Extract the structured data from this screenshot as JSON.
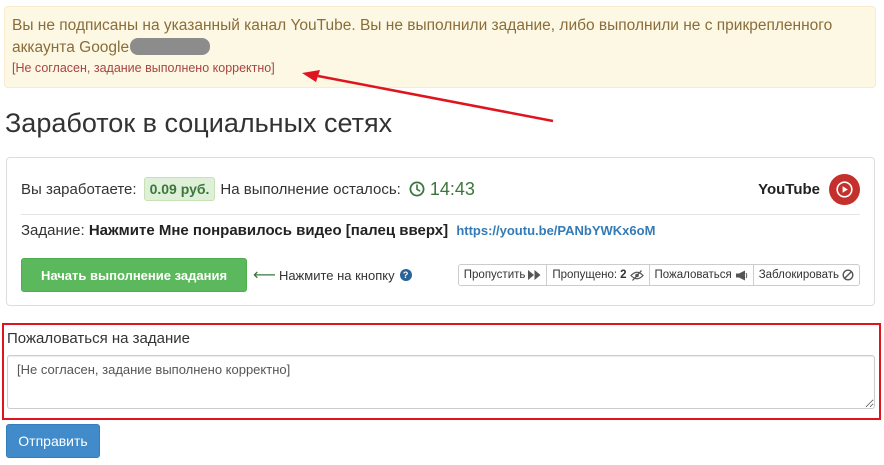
{
  "alert": {
    "message": "Вы не подписаны на указанный канал YouTube. Вы не выполнили задание, либо выполнили не с прикрепленного аккаунта Google",
    "dispute_link": "[Не согласен, задание выполнено корректно]"
  },
  "page": {
    "title": "Заработок в социальных сетях"
  },
  "task": {
    "earn_label": "Вы заработаете:",
    "amount": "0.09 руб.",
    "time_label": "На выполнение осталось:",
    "time_left": "14:43",
    "service": "YouTube",
    "task_label": "Задание:",
    "task_text": "Нажмите Мне понравилось видео [палец вверх]",
    "link": "https://youtu.be/PANbYWKx6oM",
    "start_button": "Начать выполнение задания",
    "hint": "Нажмите на кнопку",
    "actions": {
      "skip": "Пропустить",
      "skipped_label": "Пропущено:",
      "skipped_count": "2",
      "complain": "Пожаловаться",
      "block": "Заблокировать"
    }
  },
  "complaint": {
    "label": "Пожаловаться на задание",
    "value": "[Не согласен, задание выполнено корректно]",
    "submit": "Отправить"
  },
  "colors": {
    "alert_bg": "#fcf8e3",
    "success_green": "#5cb85c",
    "primary_blue": "#428bca",
    "annotation_red": "#e0141e",
    "youtube_red": "#c4302b"
  }
}
